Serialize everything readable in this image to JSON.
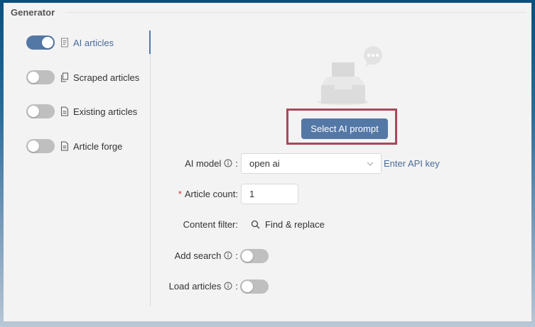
{
  "section": {
    "title": "Generator"
  },
  "sidebar": {
    "items": [
      {
        "label": "AI articles",
        "enabled": true,
        "icon": "document-icon"
      },
      {
        "label": "Scraped articles",
        "enabled": false,
        "icon": "copy-icon"
      },
      {
        "label": "Existing articles",
        "enabled": false,
        "icon": "file-icon"
      },
      {
        "label": "Article forge",
        "enabled": false,
        "icon": "file-icon"
      }
    ]
  },
  "main": {
    "select_prompt_label": "Select AI prompt",
    "ai_model": {
      "label": "AI model",
      "value": "open ai",
      "link": "Enter API key"
    },
    "article_count": {
      "label": "Article count:",
      "required_mark": "*",
      "value": "1"
    },
    "content_filter": {
      "label": "Content filter:",
      "action": "Find & replace"
    },
    "add_search": {
      "label": "Add search",
      "enabled": false
    },
    "load_articles": {
      "label": "Load articles",
      "enabled": false
    }
  },
  "colors": {
    "accent": "#5478a6",
    "highlight": "#a8485a",
    "link": "#4a6c99"
  }
}
